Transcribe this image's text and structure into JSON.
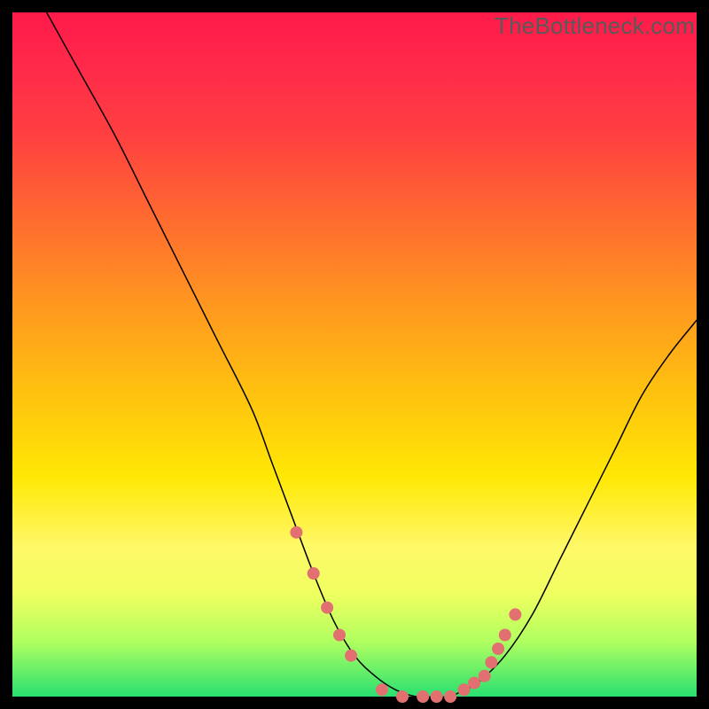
{
  "watermark": "TheBottleneck.com",
  "chart_data": {
    "type": "line",
    "title": "",
    "xlabel": "",
    "ylabel": "",
    "xlim": [
      0,
      100
    ],
    "ylim": [
      0,
      100
    ],
    "series": [
      {
        "name": "bottleneck-curve",
        "x": [
          5,
          10,
          15,
          20,
          25,
          30,
          35,
          38,
          41,
          44,
          47,
          50,
          53,
          56,
          59,
          62,
          64,
          66,
          68,
          72,
          76,
          80,
          84,
          88,
          92,
          96,
          100
        ],
        "y": [
          100,
          91,
          82,
          72,
          62,
          52,
          42,
          34,
          26,
          18,
          11,
          6,
          3,
          1,
          0,
          0,
          0,
          1,
          2,
          6,
          12,
          20,
          28,
          36,
          44,
          50,
          55
        ]
      }
    ],
    "markers": {
      "name": "highlight-dots",
      "x": [
        41.5,
        44.0,
        46.0,
        47.8,
        49.5,
        54.0,
        57.0,
        60.0,
        62.0,
        64.0,
        66.0,
        67.5,
        69.0,
        70.0,
        71.0,
        72.0,
        73.5
      ],
      "y": [
        24,
        18,
        13,
        9,
        6,
        1,
        0,
        0,
        0,
        0,
        1,
        2,
        3,
        5,
        7,
        9,
        12
      ]
    },
    "gradient_stops": [
      {
        "pos": 0,
        "color": "#ff1a4a"
      },
      {
        "pos": 50,
        "color": "#ffd010"
      },
      {
        "pos": 100,
        "color": "#28e070"
      }
    ]
  }
}
